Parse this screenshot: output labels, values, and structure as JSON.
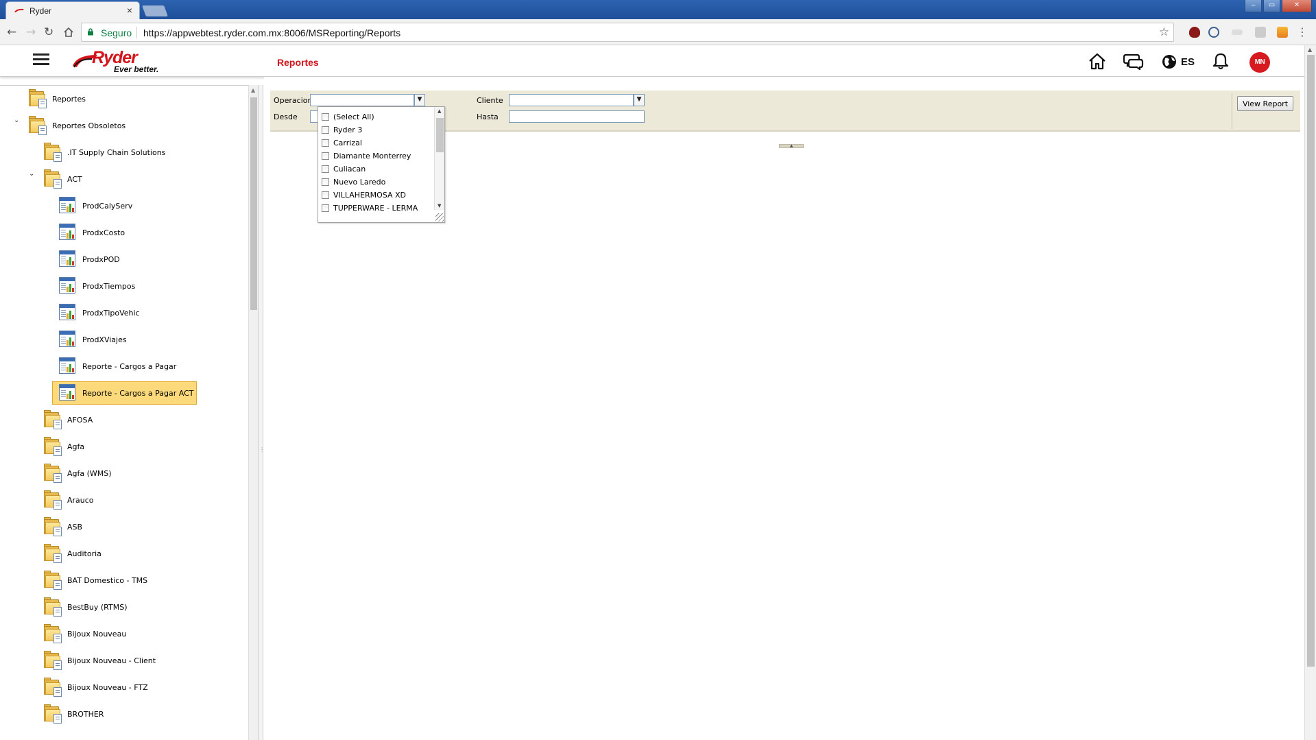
{
  "browser": {
    "tab_title": "Ryder",
    "tab_close": "×",
    "secure_label": "Seguro",
    "url": "https://appwebtest.ryder.com.mx:8006/MSReporting/Reports",
    "window_controls": [
      "‒",
      "▭",
      "✕"
    ]
  },
  "header": {
    "logo_text": "Ryder",
    "logo_tagline": "Ever better.",
    "page_title": "Reportes",
    "language": "ES",
    "user_initials": "MN",
    "brand_color": "#d3141b"
  },
  "tree": {
    "items": [
      {
        "label": "Reportes",
        "icon": "folder-icon",
        "level": 0,
        "toggle": ""
      },
      {
        "label": "Reportes Obsoletos",
        "icon": "folder-icon",
        "level": 0,
        "toggle": "⌄"
      },
      {
        "label": ".IT Supply Chain Solutions",
        "icon": "folder-icon",
        "level": 1,
        "toggle": ""
      },
      {
        "label": "ACT",
        "icon": "folder-icon",
        "level": 1,
        "toggle": "⌄"
      },
      {
        "label": "ProdCalyServ",
        "icon": "report-icon",
        "level": 2,
        "toggle": ""
      },
      {
        "label": "ProdxCosto",
        "icon": "report-icon",
        "level": 2,
        "toggle": ""
      },
      {
        "label": "ProdxPOD",
        "icon": "report-icon",
        "level": 2,
        "toggle": ""
      },
      {
        "label": "ProdxTiempos",
        "icon": "report-icon",
        "level": 2,
        "toggle": ""
      },
      {
        "label": "ProdxTipoVehic",
        "icon": "report-icon",
        "level": 2,
        "toggle": ""
      },
      {
        "label": "ProdXViajes",
        "icon": "report-icon",
        "level": 2,
        "toggle": ""
      },
      {
        "label": "Reporte - Cargos a Pagar",
        "icon": "report-icon",
        "level": 2,
        "toggle": ""
      },
      {
        "label": "Reporte - Cargos a Pagar ACT",
        "icon": "report-icon",
        "level": 2,
        "toggle": "",
        "selected": true
      },
      {
        "label": "AFOSA",
        "icon": "folder-icon",
        "level": 1,
        "toggle": ""
      },
      {
        "label": "Agfa",
        "icon": "folder-icon",
        "level": 1,
        "toggle": ""
      },
      {
        "label": "Agfa (WMS)",
        "icon": "folder-icon",
        "level": 1,
        "toggle": ""
      },
      {
        "label": "Arauco",
        "icon": "folder-icon",
        "level": 1,
        "toggle": ""
      },
      {
        "label": "ASB",
        "icon": "folder-icon",
        "level": 1,
        "toggle": ""
      },
      {
        "label": "Auditoria",
        "icon": "folder-icon",
        "level": 1,
        "toggle": ""
      },
      {
        "label": "BAT Domestico - TMS",
        "icon": "folder-icon",
        "level": 1,
        "toggle": ""
      },
      {
        "label": "BestBuy (RTMS)",
        "icon": "folder-icon",
        "level": 1,
        "toggle": ""
      },
      {
        "label": "Bijoux Nouveau",
        "icon": "folder-icon",
        "level": 1,
        "toggle": ""
      },
      {
        "label": "Bijoux Nouveau - Client",
        "icon": "folder-icon",
        "level": 1,
        "toggle": ""
      },
      {
        "label": "Bijoux Nouveau - FTZ",
        "icon": "folder-icon",
        "level": 1,
        "toggle": ""
      },
      {
        "label": "BROTHER",
        "icon": "folder-icon",
        "level": 1,
        "toggle": ""
      }
    ]
  },
  "params": {
    "operacion_label": "Operacion",
    "cliente_label": "Cliente",
    "desde_label": "Desde",
    "hasta_label": "Hasta",
    "view_report_label": "View Report",
    "operacion_value": "",
    "cliente_value": "",
    "desde_value": "",
    "hasta_value": "",
    "operacion_options": [
      "(Select All)",
      "Ryder 3",
      "Carrizal",
      "Diamante Monterrey",
      "Culiacan",
      "Nuevo Laredo",
      "VILLAHERMOSA XD",
      "TUPPERWARE - LERMA"
    ]
  }
}
